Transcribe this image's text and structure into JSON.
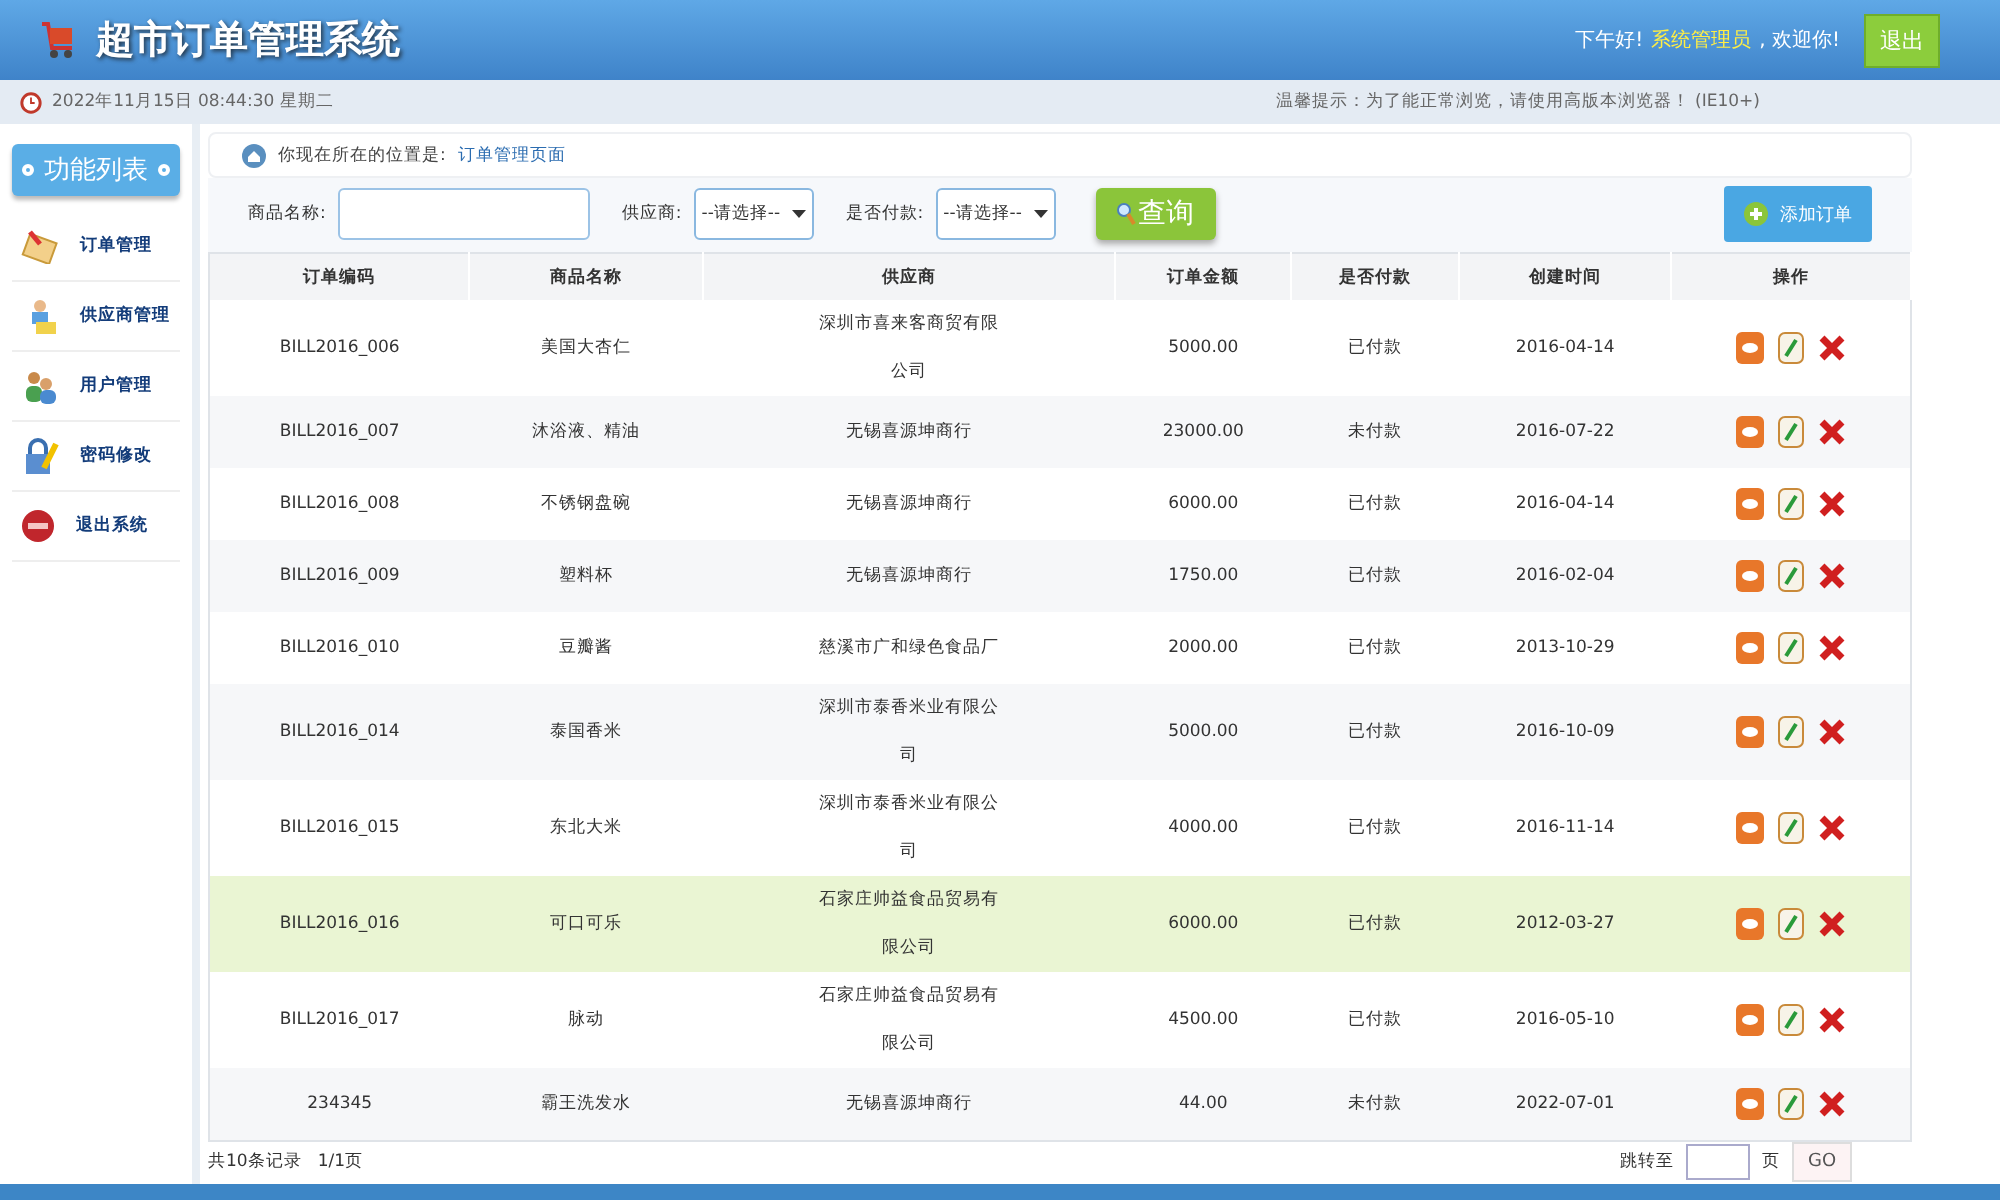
{
  "header": {
    "title": "超市订单管理系统",
    "greeting": "下午好!",
    "user": "系统管理员",
    "welcome": ", 欢迎你!",
    "logout": "退出"
  },
  "info_bar": {
    "datetime": "2022年11月15日 08:44:30 星期二",
    "notice": "温馨提示：为了能正常浏览，请使用高版本浏览器！ (IE10+)"
  },
  "sidebar": {
    "title": "功能列表",
    "items": [
      {
        "label": "订单管理",
        "kind": "order"
      },
      {
        "label": "供应商管理",
        "kind": "provider"
      },
      {
        "label": "用户管理",
        "kind": "user"
      },
      {
        "label": "密码修改",
        "kind": "password"
      },
      {
        "label": "退出系统",
        "kind": "exit"
      }
    ]
  },
  "breadcrumb": {
    "prefix": "你现在所在的位置是:",
    "page": "订单管理页面"
  },
  "search": {
    "name_label": "商品名称:",
    "provider_label": "供应商:",
    "provider_value": "--请选择--",
    "paid_label": "是否付款:",
    "paid_value": "--请选择--",
    "query": "查询",
    "add": "添加订单"
  },
  "table": {
    "columns": [
      "订单编码",
      "商品名称",
      "供应商",
      "订单金额",
      "是否付款",
      "创建时间",
      "操作"
    ],
    "rows": [
      {
        "code": "BILL2016_006",
        "product": "美国大杏仁",
        "provider": "深圳市喜来客商贸有限公司",
        "amount": "5000.00",
        "paid": "已付款",
        "created": "2016-04-14",
        "selected": false
      },
      {
        "code": "BILL2016_007",
        "product": "沐浴液、精油",
        "provider": "无锡喜源坤商行",
        "amount": "23000.00",
        "paid": "未付款",
        "created": "2016-07-22",
        "selected": false
      },
      {
        "code": "BILL2016_008",
        "product": "不锈钢盘碗",
        "provider": "无锡喜源坤商行",
        "amount": "6000.00",
        "paid": "已付款",
        "created": "2016-04-14",
        "selected": false
      },
      {
        "code": "BILL2016_009",
        "product": "塑料杯",
        "provider": "无锡喜源坤商行",
        "amount": "1750.00",
        "paid": "已付款",
        "created": "2016-02-04",
        "selected": false
      },
      {
        "code": "BILL2016_010",
        "product": "豆瓣酱",
        "provider": "慈溪市广和绿色食品厂",
        "amount": "2000.00",
        "paid": "已付款",
        "created": "2013-10-29",
        "selected": false
      },
      {
        "code": "BILL2016_014",
        "product": "泰国香米",
        "provider": "深圳市泰香米业有限公司",
        "amount": "5000.00",
        "paid": "已付款",
        "created": "2016-10-09",
        "selected": false
      },
      {
        "code": "BILL2016_015",
        "product": "东北大米",
        "provider": "深圳市泰香米业有限公司",
        "amount": "4000.00",
        "paid": "已付款",
        "created": "2016-11-14",
        "selected": false
      },
      {
        "code": "BILL2016_016",
        "product": "可口可乐",
        "provider": "石家庄帅益食品贸易有限公司",
        "amount": "6000.00",
        "paid": "已付款",
        "created": "2012-03-27",
        "selected": true
      },
      {
        "code": "BILL2016_017",
        "product": "脉动",
        "provider": "石家庄帅益食品贸易有限公司",
        "amount": "4500.00",
        "paid": "已付款",
        "created": "2016-05-10",
        "selected": false
      },
      {
        "code": "234345",
        "product": "霸王洗发水",
        "provider": "无锡喜源坤商行",
        "amount": "44.00",
        "paid": "未付款",
        "created": "2022-07-01",
        "selected": false
      }
    ]
  },
  "pager": {
    "summary": "共10条记录",
    "pages": "1/1页",
    "jump_label": "跳转至",
    "page_unit": "页",
    "go": "GO"
  }
}
